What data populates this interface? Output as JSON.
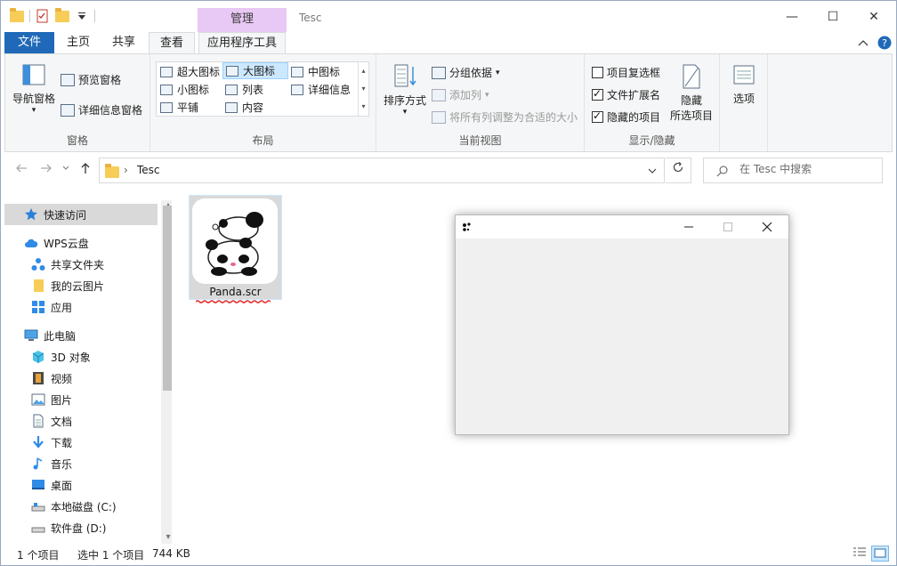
{
  "titlebar": {
    "contextual_tab": "管理",
    "title": "Tesc",
    "controls": {
      "minimize": "—",
      "maximize": "☐",
      "close": "✕"
    }
  },
  "ribbon_tabs": {
    "file": "文件",
    "home": "主页",
    "share": "共享",
    "view": "查看",
    "app_tools": "应用程序工具"
  },
  "ribbon": {
    "panes": {
      "label": "窗格",
      "nav_pane": "导航窗格",
      "preview_pane": "预览窗格",
      "details_pane": "详细信息窗格"
    },
    "layout": {
      "label": "布局",
      "items": [
        "超大图标",
        "大图标",
        "中图标",
        "小图标",
        "列表",
        "详细信息",
        "平铺",
        "内容"
      ],
      "selected": "大图标"
    },
    "current_view": {
      "label": "当前视图",
      "sort_by": "排序方式",
      "group_by": "分组依据",
      "add_column": "添加列",
      "size_columns": "将所有列调整为合适的大小"
    },
    "show_hide": {
      "label": "显示/隐藏",
      "item_checkboxes": "项目复选框",
      "file_extensions": "文件扩展名",
      "hidden_items": "隐藏的项目",
      "hide_selected_line1": "隐藏",
      "hide_selected_line2": "所选项目",
      "checkbox_states": {
        "item_checkboxes": false,
        "file_extensions": true,
        "hidden_items": true
      }
    },
    "options": "选项"
  },
  "nav": {
    "path": "Tesc",
    "search_placeholder": "在 Tesc 中搜索"
  },
  "sidebar": {
    "items": [
      {
        "label": "快速访问",
        "icon": "star-icon"
      },
      {
        "label": "WPS云盘",
        "icon": "cloud-icon"
      },
      {
        "label": "共享文件夹",
        "icon": "share-folder-icon"
      },
      {
        "label": "我的云图片",
        "icon": "folder-icon"
      },
      {
        "label": "应用",
        "icon": "apps-icon"
      },
      {
        "label": "此电脑",
        "icon": "computer-icon"
      },
      {
        "label": "3D 对象",
        "icon": "cube-icon"
      },
      {
        "label": "视频",
        "icon": "video-icon"
      },
      {
        "label": "图片",
        "icon": "picture-icon"
      },
      {
        "label": "文档",
        "icon": "document-icon"
      },
      {
        "label": "下载",
        "icon": "download-icon"
      },
      {
        "label": "音乐",
        "icon": "music-icon"
      },
      {
        "label": "桌面",
        "icon": "desktop-icon"
      },
      {
        "label": "本地磁盘 (C:)",
        "icon": "drive-icon"
      },
      {
        "label": "软件盘 (D:)",
        "icon": "drive-icon"
      }
    ]
  },
  "files": [
    {
      "name": "Panda.scr",
      "icon": "panda-icon"
    }
  ],
  "status": {
    "count": "1 个项目",
    "selected": "选中 1 个项目",
    "size": "744 KB"
  },
  "colors": {
    "file_tab": "#1f69b8",
    "contextual_tab": "#e8c8f4",
    "selection": "#cce8ff",
    "squiggle": "#e53935"
  }
}
